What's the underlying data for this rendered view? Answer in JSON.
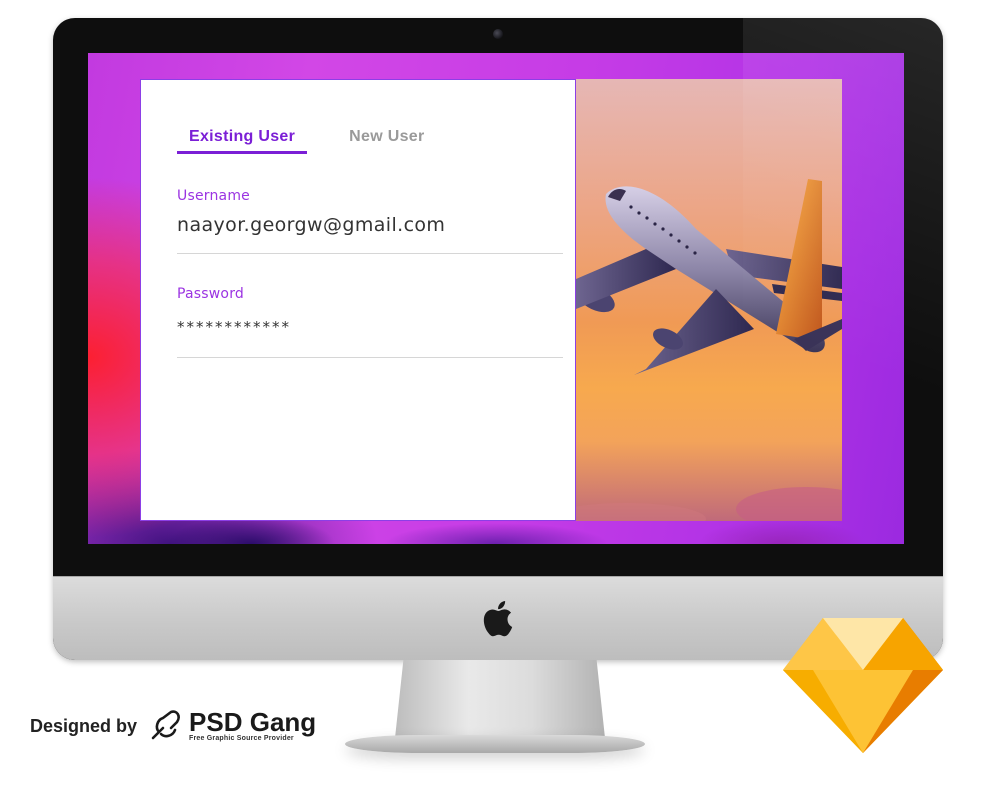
{
  "login": {
    "tabs": [
      {
        "label": "Existing User",
        "active": true
      },
      {
        "label": "New User",
        "active": false
      }
    ],
    "username": {
      "label": "Username",
      "value": "naayor.georgw@gmail.com"
    },
    "password": {
      "label": "Password",
      "value": "************"
    }
  },
  "photo": {
    "icon": "airplane-photo"
  },
  "device": {
    "logo_icon": "apple-icon",
    "camera_icon": "camera-icon"
  },
  "credit": {
    "prefix": "Designed by",
    "brand": "PSD Gang",
    "tagline": "Free Graphic Source Provider",
    "logo_icon": "psd-gang-logo-icon"
  },
  "sketch": {
    "icon": "sketch-diamond-icon"
  },
  "colors": {
    "accent": "#7b1fd6",
    "label": "#9b34e2",
    "inactive_tab": "#9a9a9a",
    "screen_purple": "#c63ce6",
    "sky_orange": "#f09a55",
    "sketch_gold": "#fdb300"
  }
}
